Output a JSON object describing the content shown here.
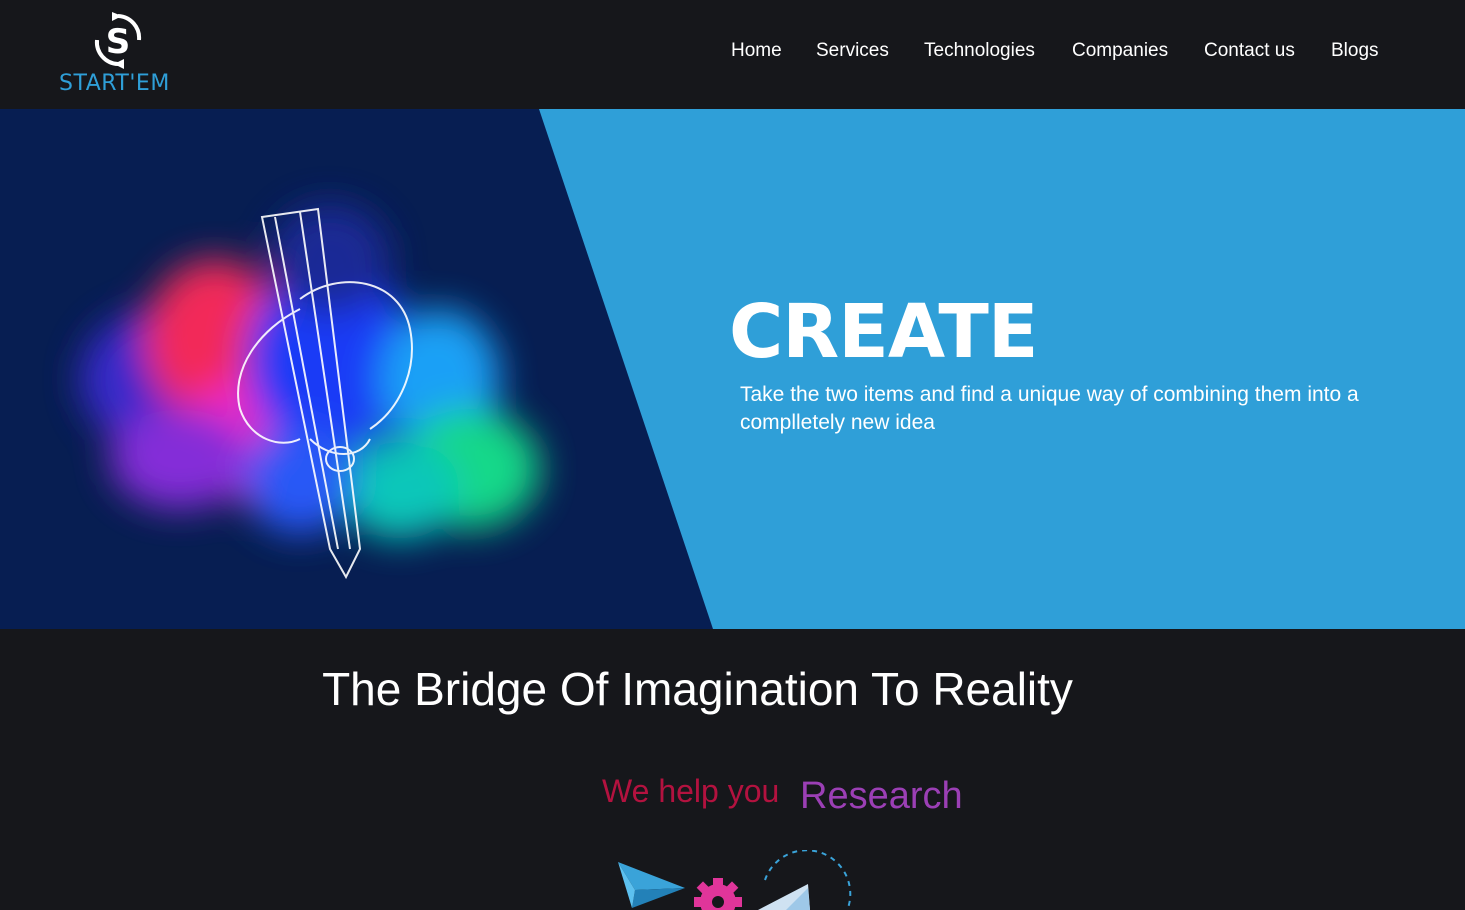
{
  "brand": {
    "name": "START'EM",
    "logo_icon": "s-cycle-logo-icon",
    "accent_color": "#2f9fd8"
  },
  "nav": {
    "items": [
      {
        "label": "Home"
      },
      {
        "label": "Services"
      },
      {
        "label": "Technologies"
      },
      {
        "label": "Companies"
      },
      {
        "label": "Contact us"
      },
      {
        "label": "Blogs"
      }
    ]
  },
  "hero": {
    "title": "CREATE",
    "text": "Take the two items and find a unique way of combining them into a complletely new idea",
    "image_icon": "neon-pencil-illustration",
    "left_color": "#071e52",
    "right_color": "#2f9fd8"
  },
  "section": {
    "heading": "The Bridge Of Imagination To Reality",
    "help_prefix": "We help you",
    "help_word": "Research",
    "prefix_color": "#b3123f",
    "word_color": "#9b3fb5",
    "illustration_icons": [
      "paper-plane-icon",
      "gear-icon",
      "document-icon"
    ]
  }
}
